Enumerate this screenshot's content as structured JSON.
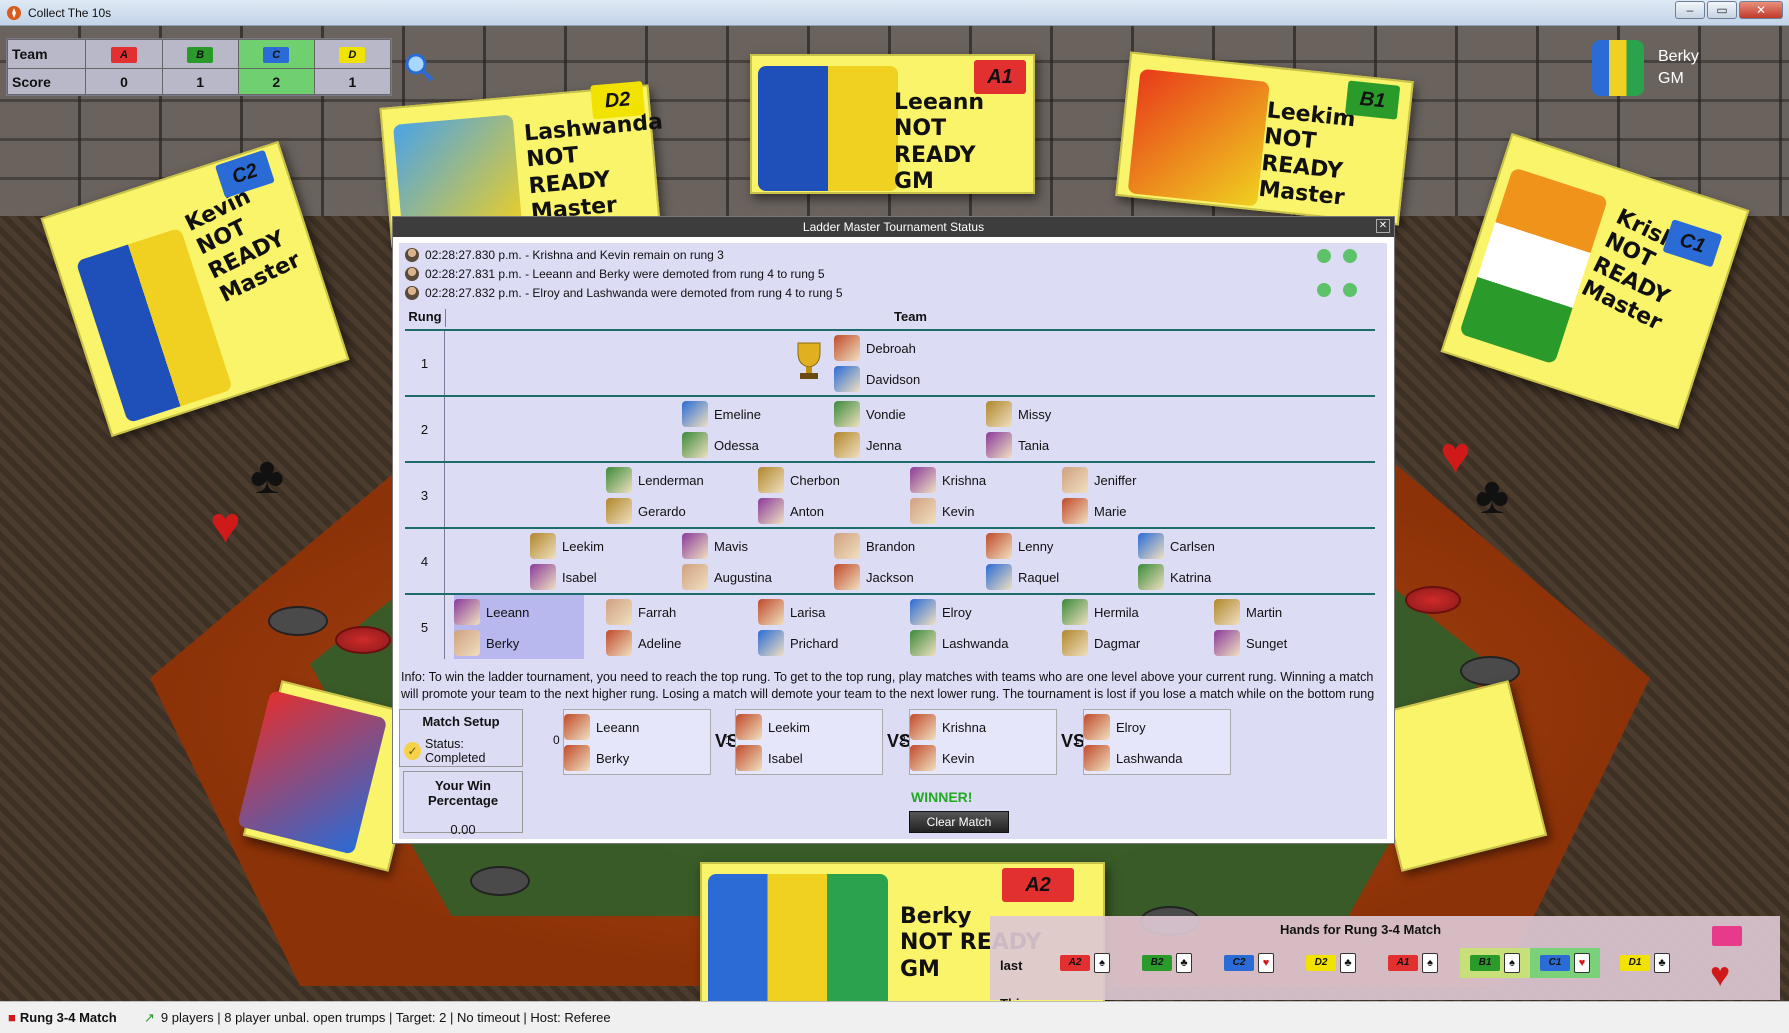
{
  "window": {
    "title": "Collect The 10s",
    "btn_min": "–",
    "btn_max": "▭",
    "btn_close": "✕"
  },
  "scoreboard": {
    "team_label": "Team",
    "score_label": "Score",
    "flags": [
      "A",
      "B",
      "C",
      "D"
    ],
    "flag_colors": [
      "#e23030",
      "#2a9a2a",
      "#2a6bd6",
      "#f2e200"
    ],
    "scores": [
      "0",
      "1",
      "2",
      "1"
    ],
    "highlighted_index": 2
  },
  "user": {
    "name": "Berky",
    "role": "GM"
  },
  "seat_cards": [
    {
      "name": "Kevin",
      "status": "NOT READY",
      "role": "Master",
      "flag": "C2",
      "flag_color": "#2a6bd6"
    },
    {
      "name": "Lashwanda",
      "status": "NOT READY",
      "role": "Master",
      "flag": "D2",
      "flag_color": "#f2e200"
    },
    {
      "name": "Leeann",
      "status": "NOT READY",
      "role": "GM",
      "flag": "A1",
      "flag_color": "#e23030"
    },
    {
      "name": "Leekim",
      "status": "NOT READY",
      "role": "Master",
      "flag": "B1",
      "flag_color": "#2a9a2a"
    },
    {
      "name": "Krishna",
      "status": "NOT READY",
      "role": "Master",
      "flag": "C1",
      "flag_color": "#2a6bd6"
    },
    {
      "name": "Berky",
      "status": "NOT READY",
      "role": "GM",
      "flag": "A2",
      "flag_color": "#e23030"
    }
  ],
  "dialog": {
    "title": "Ladder Master Tournament Status",
    "close": "✕",
    "log": [
      "02:28:27.830 p.m. - Krishna and Kevin remain on rung 3",
      "02:28:27.831 p.m. - Leeann and Berky were demoted from rung 4 to rung 5",
      "02:28:27.832 p.m. - Elroy and Lashwanda were demoted from rung 4 to rung 5"
    ],
    "rung_header": "Rung",
    "team_header": "Team",
    "rungs": [
      {
        "rung": "1",
        "teams": [
          [
            "Debroah",
            "Davidson"
          ]
        ]
      },
      {
        "rung": "2",
        "teams": [
          [
            "Emeline",
            "Odessa"
          ],
          [
            "Vondie",
            "Jenna"
          ],
          [
            "Missy",
            "Tania"
          ]
        ]
      },
      {
        "rung": "3",
        "teams": [
          [
            "Lenderman",
            "Gerardo"
          ],
          [
            "Cherbon",
            "Anton"
          ],
          [
            "Krishna",
            "Kevin"
          ],
          [
            "Jeniffer",
            "Marie"
          ]
        ]
      },
      {
        "rung": "4",
        "teams": [
          [
            "Leekim",
            "Isabel"
          ],
          [
            "Mavis",
            "Augustina"
          ],
          [
            "Brandon",
            "Jackson"
          ],
          [
            "Lenny",
            "Raquel"
          ],
          [
            "Carlsen",
            "Katrina"
          ]
        ]
      },
      {
        "rung": "5",
        "teams": [
          [
            "Leeann",
            "Berky"
          ],
          [
            "Farrah",
            "Adeline"
          ],
          [
            "Larisa",
            "Prichard"
          ],
          [
            "Elroy",
            "Lashwanda"
          ],
          [
            "Hermila",
            "Dagmar"
          ],
          [
            "Martin",
            "Sunget"
          ]
        ]
      }
    ],
    "info": "Info: To win the ladder tournament, you need to reach the top rung. To get to the top rung, play matches with teams who are one level above your current rung. Winning a match will promote your team to the next higher rung. Losing a match will demote your team to the next lower rung. The tournament is lost if you lose a match while on the bottom rung",
    "match_setup": {
      "header": "Match Setup",
      "status": "Status: Completed"
    },
    "win_percentage": {
      "header": "Your Win Percentage",
      "value": "0.00"
    },
    "match": [
      {
        "score": "0",
        "players": [
          "Leeann",
          "Berky"
        ]
      },
      {
        "score": "1",
        "players": [
          "Leekim",
          "Isabel"
        ]
      },
      {
        "score": "2",
        "players": [
          "Krishna",
          "Kevin"
        ]
      },
      {
        "score": "1",
        "players": [
          "Elroy",
          "Lashwanda"
        ]
      }
    ],
    "vs": "VS",
    "winner": "WINNER!",
    "clear_button": "Clear Match"
  },
  "hands": {
    "header": "Hands for Rung 3-4 Match",
    "last_label": "last",
    "this_label": "This",
    "items": [
      {
        "flag": "A2",
        "color": "#e23030",
        "card": "♠"
      },
      {
        "flag": "B2",
        "color": "#2a9a2a",
        "card": "♣"
      },
      {
        "flag": "C2",
        "color": "#2a6bd6",
        "card": "♥"
      },
      {
        "flag": "D2",
        "color": "#f2e200",
        "card": "♣"
      },
      {
        "flag": "A1",
        "color": "#e23030",
        "card": "♠"
      },
      {
        "flag": "B1",
        "color": "#2a9a2a",
        "card": "♠"
      },
      {
        "flag": "C1",
        "color": "#2a6bd6",
        "card": "♥"
      },
      {
        "flag": "D1",
        "color": "#f2e200",
        "card": "♣"
      }
    ]
  },
  "statusbar": {
    "match_label": "Rung 3-4 Match",
    "info": "9 players | 8 player unbal. open trumps | Target: 2 | No timeout | Host: Referee"
  }
}
